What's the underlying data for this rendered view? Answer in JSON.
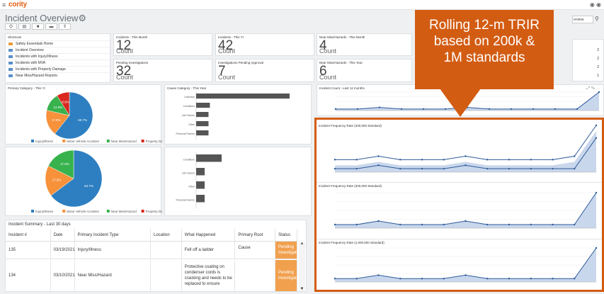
{
  "topbar": {
    "menu_icon": "hamburger-icon",
    "logo": "cority",
    "icons": "◉ ◉"
  },
  "page": {
    "title": "Incident Overview"
  },
  "toolbar": {
    "buttons": [
      "⛭",
      "▤",
      "■",
      "▬",
      "⇕"
    ]
  },
  "search": {
    "value": "erview"
  },
  "shortcuts": {
    "title": "Shortcuts",
    "items": [
      "Safety Essentials Home",
      "Incident Overview",
      "Incidents with Injury/Illness",
      "Incidents with MVA",
      "Incidents with Property Damage",
      "Near Miss/Hazard Reports"
    ]
  },
  "kpis": [
    {
      "title": "Incidents - This Month",
      "value": "12",
      "unit": "Count"
    },
    {
      "title": "Incidents - This Yr",
      "value": "42",
      "unit": "Count"
    },
    {
      "title": "Near Miss/Hazards - This Month",
      "value": "4",
      "unit": "Count"
    },
    {
      "title": "Pending Investigations",
      "value": "32",
      "unit": "Count"
    },
    {
      "title": "Investigations Pending Approval",
      "value": "7",
      "unit": "Count"
    },
    {
      "title": "Near Miss/Hazards - This Year",
      "value": "6",
      "unit": "Count"
    }
  ],
  "mini_table_values": [
    "2",
    "2",
    "2",
    "1"
  ],
  "charts": {
    "primary_category_title": "Primary Category - This Yr",
    "cause_category_title": "Cause Category - This Year",
    "incident_count_title": "Incident Count - Last 12 months",
    "ifr_200k_title": "Incident Frequency Rate (200,000 Standard)",
    "ifr_200k_2_title": "Incident Frequency Rate (200,000 Standard)",
    "ifr_1m_title": "Incident Frequency Rate (1,000,000 Standard)",
    "legend": [
      "Injury/Illness",
      "Motor Vehicle Accident",
      "Near Miss/Hazard",
      "Property Damage"
    ]
  },
  "chart_data": [
    {
      "type": "pie",
      "title": "Primary Category - This Yr",
      "categories": [
        "Injury/Illness",
        "Motor Vehicle Accident",
        "Near Miss/Hazard",
        "Property Damage"
      ],
      "values": [
        60.7,
        17.9,
        12.5,
        8.9
      ],
      "colors": [
        "#2e7fc1",
        "#f7913a",
        "#37b24d",
        "#d9281e"
      ]
    },
    {
      "type": "bar",
      "title": "Cause Category - This Year",
      "categories": [
        "Unknown",
        "Conditions",
        "Job Factors",
        "Other",
        "Personal Factors"
      ],
      "values": [
        6.8,
        1,
        0.9,
        0.9,
        0.9
      ]
    },
    {
      "type": "pie",
      "categories": [
        "Injury/Illness",
        "Motor Vehicle Accident",
        "Near Miss/Hazard"
      ],
      "values": [
        64.7,
        17.6,
        17.6
      ],
      "colors": [
        "#2e7fc1",
        "#f7913a",
        "#37b24d"
      ]
    },
    {
      "type": "bar",
      "categories": [
        "Conditions",
        "Job Factors",
        "Other",
        "Personal Factors"
      ],
      "values": [
        3,
        1,
        1,
        1
      ]
    },
    {
      "type": "area",
      "title": "Incident Count - Last 12 months",
      "values": [
        1,
        1,
        2,
        1,
        1,
        1,
        2,
        1,
        1,
        1,
        1,
        1,
        12
      ]
    },
    {
      "type": "line",
      "title": "Incident Frequency Rate (200,000 Standard)",
      "series": [
        {
          "values": [
            2,
            2,
            3,
            2,
            2,
            2,
            3,
            2,
            2,
            2,
            2,
            3,
            12
          ]
        },
        {
          "values": [
            1,
            1,
            2,
            1,
            1,
            1,
            2,
            1,
            1,
            1,
            1,
            1,
            10
          ]
        }
      ]
    },
    {
      "type": "area",
      "title": "Incident Frequency Rate (200,000 Standard)",
      "values": [
        1,
        1,
        2,
        1,
        1,
        1,
        2,
        1,
        1,
        1,
        1,
        1,
        10
      ]
    },
    {
      "type": "area",
      "title": "Incident Frequency Rate (1,000,000 Standard)",
      "values": [
        1,
        1,
        2,
        1,
        1,
        1,
        2,
        1,
        1,
        1,
        1,
        1,
        10
      ]
    }
  ],
  "callout": {
    "line1": "Rolling 12-m TRIR",
    "line2": "based on 200k &",
    "line3": "1M standards"
  },
  "table": {
    "title": "Incident Summary - Last 30 days",
    "headers": [
      "Incident #",
      "Date",
      "Primary Incident Type",
      "Location",
      "What Happened",
      "Primary Root Cause",
      "Status"
    ],
    "rows": [
      {
        "id": "135",
        "date": "03/19/2021",
        "type": "Injury/Illness",
        "location": "",
        "what": "Fell off a ladder",
        "cause": "",
        "status": "Pending Investigation"
      },
      {
        "id": "134",
        "date": "03/10/2021",
        "type": "Near Miss/Hazard",
        "location": "",
        "what": "Protective coating on condenser cords is cracking and needs to be replaced to ensure",
        "cause": "",
        "status": "Pending Investigation"
      }
    ]
  }
}
